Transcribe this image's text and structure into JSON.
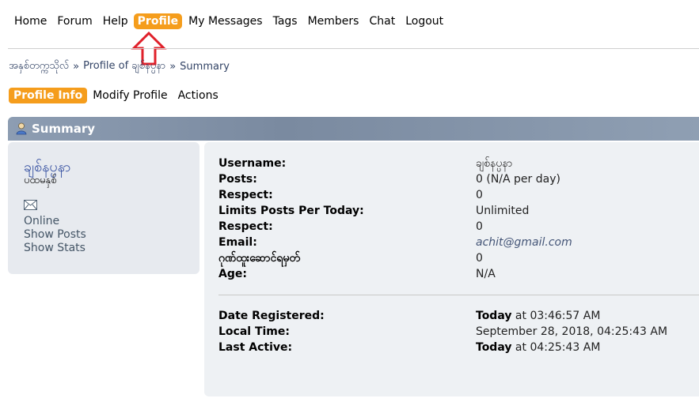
{
  "nav": {
    "items": [
      "Home",
      "Forum",
      "Help",
      "Profile",
      "My Messages",
      "Tags",
      "Members",
      "Chat",
      "Logout"
    ],
    "active": "Profile"
  },
  "breadcrumb": {
    "items": [
      "အနှစ်တက္ကသိုလ်",
      "Profile of ချစ်နပ္ပနာ",
      "Summary"
    ],
    "separator": "»"
  },
  "subtabs": {
    "items": [
      "Profile Info",
      "Modify Profile",
      "Actions"
    ],
    "active": "Profile Info"
  },
  "section_title": "Summary",
  "sidebar": {
    "display_name": "ချစ်နပ္ပနာ",
    "member_group": "ပထမနှစ်",
    "status": "Online",
    "show_posts": "Show Posts",
    "show_stats": "Show Stats"
  },
  "details": [
    {
      "label": "Username:",
      "value": "ချစ်နပ္ပနာ"
    },
    {
      "label": "Posts:",
      "value": "0 (N/A per day)"
    },
    {
      "label": "Respect:",
      "value": "0"
    },
    {
      "label": "Limits Posts Per Today:",
      "value": "Unlimited"
    },
    {
      "label": "Respect:",
      "value": "0"
    },
    {
      "label": "Email:",
      "value": "achit@gmail.com"
    },
    {
      "label": "ဂုဏ်ထူးဆောင်ရမှတ်",
      "value": "0"
    },
    {
      "label": "Age:",
      "value": "N/A"
    }
  ],
  "dates": [
    {
      "label": "Date Registered:",
      "strong": "Today",
      "rest": " at 03:46:57 AM"
    },
    {
      "label": "Local Time:",
      "strong": "",
      "rest": "September 28, 2018, 04:25:43 AM"
    },
    {
      "label": "Last Active:",
      "strong": "Today",
      "rest": " at 04:25:43 AM"
    }
  ],
  "colors": {
    "accent": "#f59d1c",
    "title_bar": "#7a8aa0",
    "panel_bg": "#eef1f4",
    "arrow": "#e0202a"
  }
}
